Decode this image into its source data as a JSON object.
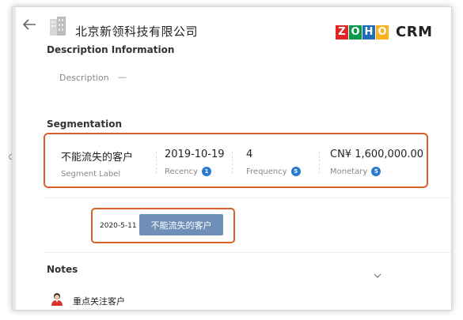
{
  "header": {
    "company_name": "北京新领科技有限公司",
    "logo_letters": [
      "Z",
      "O",
      "H",
      "O"
    ],
    "logo_colors": [
      "#e42527",
      "#089949",
      "#226db4",
      "#f9b21d"
    ],
    "product": "CRM"
  },
  "description_section": {
    "title": "Description Information",
    "label": "Description",
    "value": "—"
  },
  "segmentation": {
    "title": "Segmentation",
    "accent_color": "#d9602b",
    "segment": {
      "value": "不能流失的客户",
      "label": "Segment Label"
    },
    "recency": {
      "value": "2019-10-19",
      "label": "Recency",
      "score": "1"
    },
    "frequency": {
      "value": "4",
      "label": "Frequency",
      "score": "5"
    },
    "monetary": {
      "value": "CN¥ 1,600,000.00",
      "label": "Monetary",
      "score": "5"
    }
  },
  "history": {
    "date": "2020-5-11",
    "segment_button": "不能流失的客户",
    "button_color": "#6f8fb9"
  },
  "notes": {
    "title": "Notes",
    "items": [
      {
        "text": "重点关注客户",
        "icon": "user-avatar-icon"
      }
    ]
  }
}
